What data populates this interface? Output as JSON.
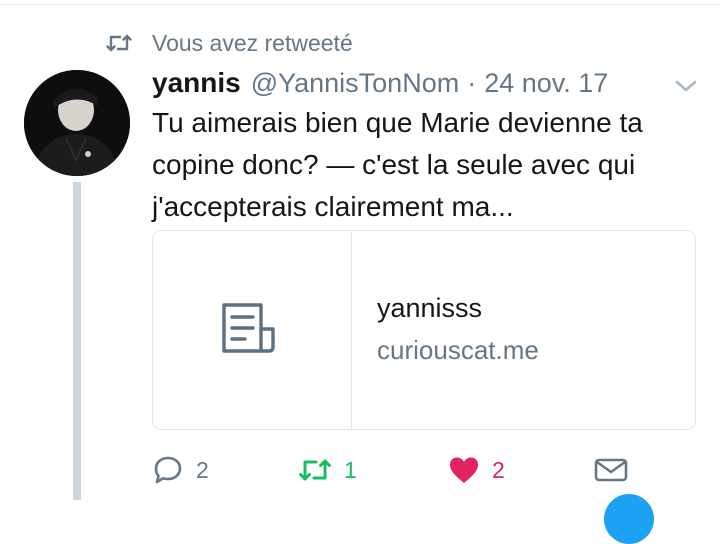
{
  "retweet_context": {
    "icon": "retweet-icon",
    "text": "Vous avez retweeté"
  },
  "tweet": {
    "author_name": "yannis",
    "author_handle": "@YannisTonNom",
    "separator": "·",
    "timestamp": "24 nov. 17",
    "avatar": "avatar-photo",
    "text_lines": [
      "Tu aimerais bien que Marie devienne ta",
      "copine donc? — c'est la seule avec qui",
      "j'accepterais clairement ma..."
    ]
  },
  "card": {
    "icon": "document-icon",
    "title": "yannisss",
    "domain": "curiouscat.me"
  },
  "actions": {
    "reply": {
      "icon": "reply-icon",
      "count": "2"
    },
    "retweet": {
      "icon": "retweet-icon",
      "count": "1",
      "active": true,
      "color": "#17bf63"
    },
    "like": {
      "icon": "heart-icon",
      "count": "2",
      "active": true,
      "color": "#e0245e"
    },
    "dm": {
      "icon": "envelope-icon"
    }
  },
  "colors": {
    "secondary_text": "#657786",
    "primary_text": "#14171a",
    "border": "#e1e8ed",
    "brand_blue": "#1da1f2"
  }
}
